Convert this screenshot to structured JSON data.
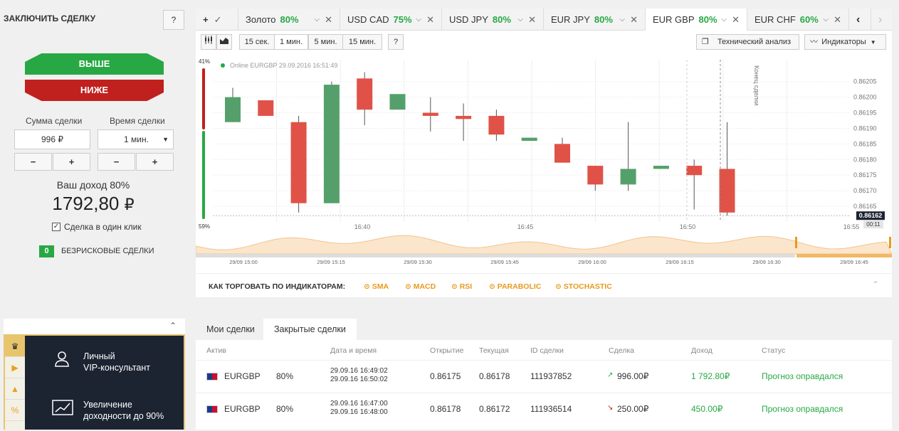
{
  "deal": {
    "title": "ЗАКЛЮЧИТЬ СДЕЛКУ",
    "help": "?",
    "up": "ВЫШЕ",
    "down": "НИЖЕ",
    "amount_label": "Сумма сделки",
    "time_label": "Время сделки",
    "amount_value": "996 ₽",
    "time_value": "1 мин.",
    "minus": "−",
    "plus": "+",
    "income_label": "Ваш доход 80%",
    "income_value": "1792,80",
    "currency": "₽",
    "one_click": "Сделка в один клик",
    "riskfree_count": "0",
    "riskfree_label": "БЕЗРИСКОВЫЕ СДЕЛКИ"
  },
  "vip": {
    "item1": "Личный VIP-консультант",
    "item1a": "Личный",
    "item1b": "VIP-консультант",
    "item2a": "Увеличение",
    "item2b": "доходности до 90%"
  },
  "tabs": {
    "add": "+",
    "items": [
      {
        "name": "Золото",
        "pct": "80%"
      },
      {
        "name": "USD CAD",
        "pct": "75%"
      },
      {
        "name": "USD JPY",
        "pct": "80%"
      },
      {
        "name": "EUR JPY",
        "pct": "80%"
      },
      {
        "name": "EUR GBP",
        "pct": "80%"
      },
      {
        "name": "EUR CHF",
        "pct": "60%"
      }
    ],
    "prev": "‹",
    "next": "›"
  },
  "toolbar": {
    "intervals": [
      "15 сек.",
      "1 мин.",
      "5 мин.",
      "15 мин."
    ],
    "help": "?",
    "tech": "Технический анализ",
    "indicators": "Индикаторы"
  },
  "chart_data": {
    "type": "candlestick",
    "status": "Online EURGBP 29.09.2016 16:51:49",
    "pct_top": "41%",
    "pct_bottom": "59%",
    "price_label": "0.86162",
    "timer": "00:11",
    "end_label": "Конец сделки",
    "y_ticks": [
      "0.86205",
      "0.86200",
      "0.86195",
      "0.86190",
      "0.86185",
      "0.86180",
      "0.86175",
      "0.86170",
      "0.86165"
    ],
    "ylim": [
      0.8616,
      0.86212
    ],
    "x_ticks": [
      "16:40",
      "16:45",
      "16:50",
      "16:55"
    ],
    "candles": [
      {
        "o": 0.86192,
        "c": 0.862,
        "h": 0.86203,
        "l": 0.86192
      },
      {
        "o": 0.86199,
        "c": 0.86194,
        "h": 0.86199,
        "l": 0.86194
      },
      {
        "o": 0.86192,
        "c": 0.86166,
        "h": 0.86194,
        "l": 0.86163
      },
      {
        "o": 0.86166,
        "c": 0.86204,
        "h": 0.86205,
        "l": 0.86166
      },
      {
        "o": 0.86206,
        "c": 0.86196,
        "h": 0.86208,
        "l": 0.86191
      },
      {
        "o": 0.86196,
        "c": 0.86201,
        "h": 0.86201,
        "l": 0.86196
      },
      {
        "o": 0.86195,
        "c": 0.86194,
        "h": 0.862,
        "l": 0.86189
      },
      {
        "o": 0.86194,
        "c": 0.86193,
        "h": 0.86198,
        "l": 0.86186
      },
      {
        "o": 0.86194,
        "c": 0.86188,
        "h": 0.86196,
        "l": 0.86186
      },
      {
        "o": 0.86186,
        "c": 0.86187,
        "h": 0.86187,
        "l": 0.86186
      },
      {
        "o": 0.86185,
        "c": 0.86179,
        "h": 0.86187,
        "l": 0.86179
      },
      {
        "o": 0.86178,
        "c": 0.86172,
        "h": 0.86178,
        "l": 0.8617
      },
      {
        "o": 0.86172,
        "c": 0.86177,
        "h": 0.86192,
        "l": 0.8617
      },
      {
        "o": 0.86177,
        "c": 0.86178,
        "h": 0.86178,
        "l": 0.86177
      },
      {
        "o": 0.86178,
        "c": 0.86175,
        "h": 0.8618,
        "l": 0.86164
      },
      {
        "o": 0.86177,
        "c": 0.86163,
        "h": 0.86192,
        "l": 0.86162
      }
    ],
    "mini_ticks": [
      "29/09 15:00",
      "29/09 15:15",
      "29/09 15:30",
      "29/09 15:45",
      "29/09 16:00",
      "29/09 16:15",
      "29/09 16:30",
      "29/09 16:45"
    ]
  },
  "indicators": {
    "label": "КАК ТОРГОВАТЬ ПО ИНДИКАТОРАМ:",
    "items": [
      "SMA",
      "MACD",
      "RSI",
      "PARABOLIC",
      "STOCHASTIC"
    ]
  },
  "trades": {
    "tab_mine": "Мои сделки",
    "tab_closed": "Закрытые сделки",
    "headers": {
      "asset": "Актив",
      "datetime": "Дата и время",
      "open": "Открытие",
      "current": "Текущая",
      "id": "ID сделки",
      "deal": "Сделка",
      "income": "Доход",
      "status": "Статус"
    },
    "rows": [
      {
        "asset": "EURGBP",
        "pct": "80%",
        "dt1": "29.09.16 16:49:02",
        "dt2": "29.09.16 16:50:02",
        "open": "0.86175",
        "current": "0.86178",
        "id": "111937852",
        "deal": "996.00₽",
        "income": "1 792.80₽",
        "status": "Прогноз оправдался",
        "dir": "up"
      },
      {
        "asset": "EURGBP",
        "pct": "80%",
        "dt1": "29.09.16 16:47:00",
        "dt2": "29.09.16 16:48:00",
        "open": "0.86178",
        "current": "0.86172",
        "id": "111936514",
        "deal": "250.00₽",
        "income": "450.00₽",
        "status": "Прогноз оправдался",
        "dir": "down"
      }
    ]
  },
  "colors": {
    "up": "#27a844",
    "down": "#c0201e",
    "candle_up": "#55a06a",
    "candle_down": "#e05247",
    "accent": "#e89a1e"
  }
}
